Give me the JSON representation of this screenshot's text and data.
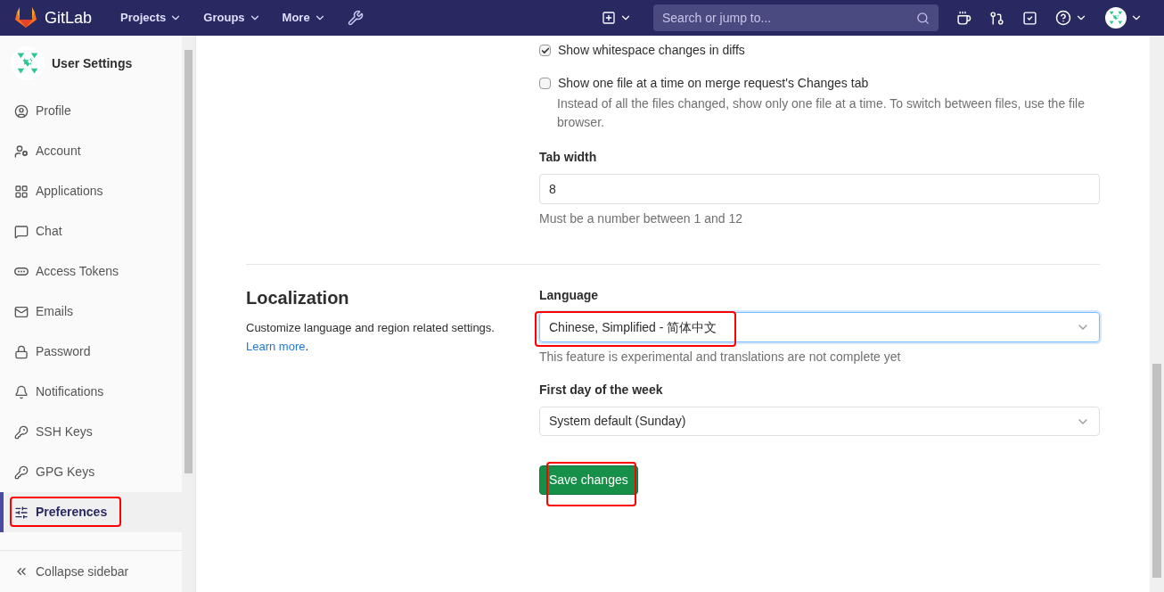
{
  "navbar": {
    "brand": "GitLab",
    "menus": [
      {
        "label": "Projects"
      },
      {
        "label": "Groups"
      },
      {
        "label": "More"
      }
    ],
    "search": {
      "placeholder": "Search or jump to..."
    }
  },
  "sidebar": {
    "title": "User Settings",
    "items": [
      {
        "label": "Profile",
        "selected": false
      },
      {
        "label": "Account",
        "selected": false
      },
      {
        "label": "Applications",
        "selected": false
      },
      {
        "label": "Chat",
        "selected": false
      },
      {
        "label": "Access Tokens",
        "selected": false
      },
      {
        "label": "Emails",
        "selected": false
      },
      {
        "label": "Password",
        "selected": false
      },
      {
        "label": "Notifications",
        "selected": false
      },
      {
        "label": "SSH Keys",
        "selected": false
      },
      {
        "label": "GPG Keys",
        "selected": false
      },
      {
        "label": "Preferences",
        "selected": true
      }
    ],
    "collapse": "Collapse sidebar"
  },
  "diffs": {
    "options": [
      {
        "label": "Show whitespace changes in diffs",
        "checked": true
      },
      {
        "label": "Show one file at a time on merge request's Changes tab",
        "checked": false,
        "help": "Instead of all the files changed, show only one file at a time. To switch between files, use the file browser."
      }
    ],
    "tab_width": {
      "label": "Tab width",
      "value": "8",
      "help": "Must be a number between 1 and 12"
    }
  },
  "localization": {
    "title": "Localization",
    "description": "Customize language and region related settings.",
    "link": "Learn more",
    "link_suffix": ".",
    "language": {
      "label": "Language",
      "value": "Chinese, Simplified - 简体中文",
      "help": "This feature is experimental and translations are not complete yet"
    },
    "first_day": {
      "label": "First day of the week",
      "value": "System default (Sunday)"
    },
    "save": "Save changes"
  }
}
